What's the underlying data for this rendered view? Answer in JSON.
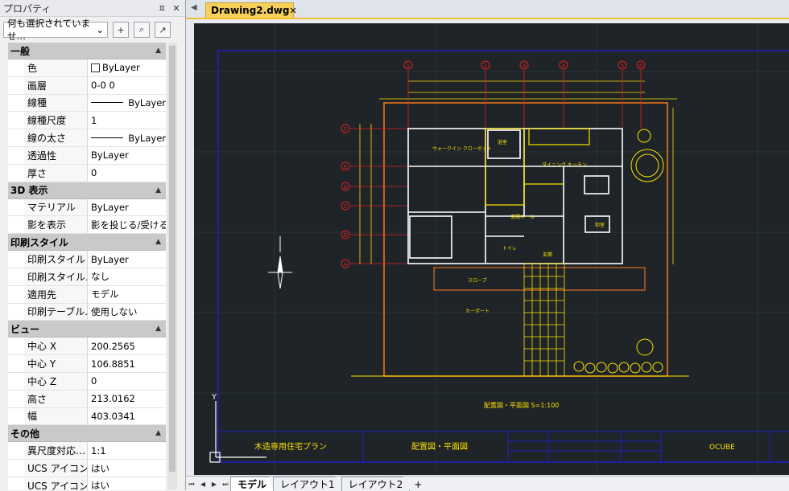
{
  "panel": {
    "title": "プロパティ",
    "ctrl_pin": "ㅍ",
    "ctrl_close": "✕",
    "selection_value": "何も選択されていませ…",
    "btn_add": "+",
    "btn_select": "⌕",
    "btn_quick": "↗"
  },
  "sections": [
    {
      "title": "一般",
      "rows": [
        {
          "k": "色",
          "v": "ByLayer"
        },
        {
          "k": "画層",
          "v": "0-0 0"
        },
        {
          "k": "線種",
          "v": "ByLayer"
        },
        {
          "k": "線種尺度",
          "v": "1"
        },
        {
          "k": "線の太さ",
          "v": "ByLayer"
        },
        {
          "k": "透過性",
          "v": "ByLayer"
        },
        {
          "k": "厚さ",
          "v": "0"
        }
      ]
    },
    {
      "title": "3D 表示",
      "rows": [
        {
          "k": "マテリアル",
          "v": "ByLayer"
        },
        {
          "k": "影を表示",
          "v": "影を投じる/受ける"
        }
      ]
    },
    {
      "title": "印刷スタイル",
      "rows": [
        {
          "k": "印刷スタイル",
          "v": "ByLayer"
        },
        {
          "k": "印刷スタイル…",
          "v": "なし"
        },
        {
          "k": "適用先",
          "v": "モデル"
        },
        {
          "k": "印刷テーブル…",
          "v": "使用しない"
        }
      ]
    },
    {
      "title": "ビュー",
      "rows": [
        {
          "k": "中心 X",
          "v": "200.2565"
        },
        {
          "k": "中心 Y",
          "v": "106.8851"
        },
        {
          "k": "中心 Z",
          "v": "0"
        },
        {
          "k": "高さ",
          "v": "213.0162"
        },
        {
          "k": "幅",
          "v": "403.0341"
        }
      ]
    },
    {
      "title": "その他",
      "rows": [
        {
          "k": "異尺度対応…",
          "v": "1:1"
        },
        {
          "k": "UCS アイコン…",
          "v": "はい"
        },
        {
          "k": "UCS アイコン…",
          "v": "はい"
        }
      ]
    }
  ],
  "doc": {
    "tab_label": "Drawing2.dwg",
    "tab_close": "✕"
  },
  "drawing": {
    "grid_labels_top": [
      "1",
      "2",
      "3",
      "4",
      "5",
      "6"
    ],
    "grid_labels_left": [
      "F",
      "E",
      "D",
      "C",
      "B",
      "A"
    ],
    "title_main": "木造専用住宅プラン",
    "title_sheet": "配置図・平面図",
    "title_company": "OCUBE",
    "plan_caption": "配置図・平面図 S=1:100",
    "room_walkin": "ウォークイン\nクローゼット",
    "room_dining": "ダイニング\nキッチン",
    "room_hall": "玄関ホール",
    "room_toilet": "トイレ",
    "room_washitsu": "和室",
    "room_bath": "浴室",
    "room_slope": "スロープ",
    "room_carport": "カーポート",
    "room_entrance": "玄関",
    "ucs_label": "Y"
  },
  "layout_tabs": [
    "モデル",
    "レイアウト1",
    "レイアウト2",
    "+"
  ],
  "colors": {
    "canvas": "#1e2428",
    "plan": "#ffe000",
    "grid_bubble": "#e02020",
    "frame": "#2020c0",
    "site": "#ff7a1a"
  }
}
